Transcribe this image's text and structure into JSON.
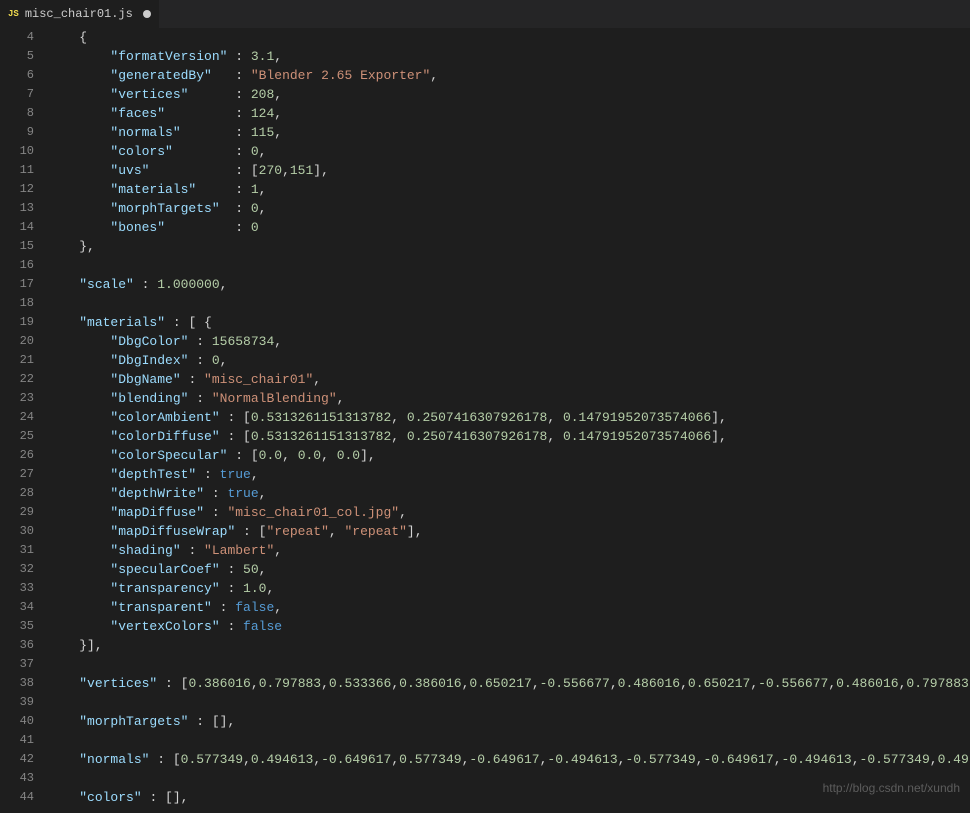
{
  "tab": {
    "filename": "misc_chair01.js",
    "js_label": "JS",
    "unsaved": true
  },
  "gutter": [
    "4",
    "5",
    "6",
    "7",
    "8",
    "9",
    "10",
    "11",
    "12",
    "13",
    "14",
    "15",
    "16",
    "17",
    "18",
    "19",
    "20",
    "21",
    "22",
    "23",
    "24",
    "25",
    "26",
    "27",
    "28",
    "29",
    "30",
    "31",
    "32",
    "33",
    "34",
    "35",
    "36",
    "37",
    "38",
    "39",
    "40",
    "41",
    "42",
    "43",
    "44"
  ],
  "code_lines": [
    [
      [
        "p",
        "    {"
      ]
    ],
    [
      [
        "p",
        "        "
      ],
      [
        "k",
        "\"formatVersion\""
      ],
      [
        "p",
        " : "
      ],
      [
        "n",
        "3.1"
      ],
      [
        "p",
        ","
      ]
    ],
    [
      [
        "p",
        "        "
      ],
      [
        "k",
        "\"generatedBy\""
      ],
      [
        "p",
        "   : "
      ],
      [
        "s",
        "\"Blender 2.65 Exporter\""
      ],
      [
        "p",
        ","
      ]
    ],
    [
      [
        "p",
        "        "
      ],
      [
        "k",
        "\"vertices\""
      ],
      [
        "p",
        "      : "
      ],
      [
        "n",
        "208"
      ],
      [
        "p",
        ","
      ]
    ],
    [
      [
        "p",
        "        "
      ],
      [
        "k",
        "\"faces\""
      ],
      [
        "p",
        "         : "
      ],
      [
        "n",
        "124"
      ],
      [
        "p",
        ","
      ]
    ],
    [
      [
        "p",
        "        "
      ],
      [
        "k",
        "\"normals\""
      ],
      [
        "p",
        "       : "
      ],
      [
        "n",
        "115"
      ],
      [
        "p",
        ","
      ]
    ],
    [
      [
        "p",
        "        "
      ],
      [
        "k",
        "\"colors\""
      ],
      [
        "p",
        "        : "
      ],
      [
        "n",
        "0"
      ],
      [
        "p",
        ","
      ]
    ],
    [
      [
        "p",
        "        "
      ],
      [
        "k",
        "\"uvs\""
      ],
      [
        "p",
        "           : ["
      ],
      [
        "n",
        "270"
      ],
      [
        "p",
        ","
      ],
      [
        "n",
        "151"
      ],
      [
        "p",
        "],"
      ]
    ],
    [
      [
        "p",
        "        "
      ],
      [
        "k",
        "\"materials\""
      ],
      [
        "p",
        "     : "
      ],
      [
        "n",
        "1"
      ],
      [
        "p",
        ","
      ]
    ],
    [
      [
        "p",
        "        "
      ],
      [
        "k",
        "\"morphTargets\""
      ],
      [
        "p",
        "  : "
      ],
      [
        "n",
        "0"
      ],
      [
        "p",
        ","
      ]
    ],
    [
      [
        "p",
        "        "
      ],
      [
        "k",
        "\"bones\""
      ],
      [
        "p",
        "         : "
      ],
      [
        "n",
        "0"
      ]
    ],
    [
      [
        "p",
        "    },"
      ]
    ],
    [
      [
        "p",
        ""
      ]
    ],
    [
      [
        "p",
        "    "
      ],
      [
        "k",
        "\"scale\""
      ],
      [
        "p",
        " : "
      ],
      [
        "n",
        "1.000000"
      ],
      [
        "p",
        ","
      ]
    ],
    [
      [
        "p",
        ""
      ]
    ],
    [
      [
        "p",
        "    "
      ],
      [
        "k",
        "\"materials\""
      ],
      [
        "p",
        " : [ {"
      ]
    ],
    [
      [
        "p",
        "        "
      ],
      [
        "k",
        "\"DbgColor\""
      ],
      [
        "p",
        " : "
      ],
      [
        "n",
        "15658734"
      ],
      [
        "p",
        ","
      ]
    ],
    [
      [
        "p",
        "        "
      ],
      [
        "k",
        "\"DbgIndex\""
      ],
      [
        "p",
        " : "
      ],
      [
        "n",
        "0"
      ],
      [
        "p",
        ","
      ]
    ],
    [
      [
        "p",
        "        "
      ],
      [
        "k",
        "\"DbgName\""
      ],
      [
        "p",
        " : "
      ],
      [
        "s",
        "\"misc_chair01\""
      ],
      [
        "p",
        ","
      ]
    ],
    [
      [
        "p",
        "        "
      ],
      [
        "k",
        "\"blending\""
      ],
      [
        "p",
        " : "
      ],
      [
        "s",
        "\"NormalBlending\""
      ],
      [
        "p",
        ","
      ]
    ],
    [
      [
        "p",
        "        "
      ],
      [
        "k",
        "\"colorAmbient\""
      ],
      [
        "p",
        " : ["
      ],
      [
        "n",
        "0.5313261151313782"
      ],
      [
        "p",
        ", "
      ],
      [
        "n",
        "0.2507416307926178"
      ],
      [
        "p",
        ", "
      ],
      [
        "n",
        "0.14791952073574066"
      ],
      [
        "p",
        "],"
      ]
    ],
    [
      [
        "p",
        "        "
      ],
      [
        "k",
        "\"colorDiffuse\""
      ],
      [
        "p",
        " : ["
      ],
      [
        "n",
        "0.5313261151313782"
      ],
      [
        "p",
        ", "
      ],
      [
        "n",
        "0.2507416307926178"
      ],
      [
        "p",
        ", "
      ],
      [
        "n",
        "0.14791952073574066"
      ],
      [
        "p",
        "],"
      ]
    ],
    [
      [
        "p",
        "        "
      ],
      [
        "k",
        "\"colorSpecular\""
      ],
      [
        "p",
        " : ["
      ],
      [
        "n",
        "0.0"
      ],
      [
        "p",
        ", "
      ],
      [
        "n",
        "0.0"
      ],
      [
        "p",
        ", "
      ],
      [
        "n",
        "0.0"
      ],
      [
        "p",
        "],"
      ]
    ],
    [
      [
        "p",
        "        "
      ],
      [
        "k",
        "\"depthTest\""
      ],
      [
        "p",
        " : "
      ],
      [
        "b",
        "true"
      ],
      [
        "p",
        ","
      ]
    ],
    [
      [
        "p",
        "        "
      ],
      [
        "k",
        "\"depthWrite\""
      ],
      [
        "p",
        " : "
      ],
      [
        "b",
        "true"
      ],
      [
        "p",
        ","
      ]
    ],
    [
      [
        "p",
        "        "
      ],
      [
        "k",
        "\"mapDiffuse\""
      ],
      [
        "p",
        " : "
      ],
      [
        "s",
        "\"misc_chair01_col.jpg\""
      ],
      [
        "p",
        ","
      ]
    ],
    [
      [
        "p",
        "        "
      ],
      [
        "k",
        "\"mapDiffuseWrap\""
      ],
      [
        "p",
        " : ["
      ],
      [
        "s",
        "\"repeat\""
      ],
      [
        "p",
        ", "
      ],
      [
        "s",
        "\"repeat\""
      ],
      [
        "p",
        "],"
      ]
    ],
    [
      [
        "p",
        "        "
      ],
      [
        "k",
        "\"shading\""
      ],
      [
        "p",
        " : "
      ],
      [
        "s",
        "\"Lambert\""
      ],
      [
        "p",
        ","
      ]
    ],
    [
      [
        "p",
        "        "
      ],
      [
        "k",
        "\"specularCoef\""
      ],
      [
        "p",
        " : "
      ],
      [
        "n",
        "50"
      ],
      [
        "p",
        ","
      ]
    ],
    [
      [
        "p",
        "        "
      ],
      [
        "k",
        "\"transparency\""
      ],
      [
        "p",
        " : "
      ],
      [
        "n",
        "1.0"
      ],
      [
        "p",
        ","
      ]
    ],
    [
      [
        "p",
        "        "
      ],
      [
        "k",
        "\"transparent\""
      ],
      [
        "p",
        " : "
      ],
      [
        "b",
        "false"
      ],
      [
        "p",
        ","
      ]
    ],
    [
      [
        "p",
        "        "
      ],
      [
        "k",
        "\"vertexColors\""
      ],
      [
        "p",
        " : "
      ],
      [
        "b",
        "false"
      ]
    ],
    [
      [
        "p",
        "    }],"
      ]
    ],
    [
      [
        "p",
        ""
      ]
    ],
    [
      [
        "p",
        "    "
      ],
      [
        "k",
        "\"vertices\""
      ],
      [
        "p",
        " : ["
      ],
      [
        "n",
        "0.386016"
      ],
      [
        "p",
        ","
      ],
      [
        "n",
        "0.797883"
      ],
      [
        "p",
        ","
      ],
      [
        "n",
        "0.533366"
      ],
      [
        "p",
        ","
      ],
      [
        "n",
        "0.386016"
      ],
      [
        "p",
        ","
      ],
      [
        "n",
        "0.650217"
      ],
      [
        "p",
        ","
      ],
      [
        "n",
        "-0.556677"
      ],
      [
        "p",
        ","
      ],
      [
        "n",
        "0.486016"
      ],
      [
        "p",
        ","
      ],
      [
        "n",
        "0.650217"
      ],
      [
        "p",
        ","
      ],
      [
        "n",
        "-0.556677"
      ],
      [
        "p",
        ","
      ],
      [
        "n",
        "0.486016"
      ],
      [
        "p",
        ","
      ],
      [
        "n",
        "0.797883"
      ]
    ],
    [
      [
        "p",
        ""
      ]
    ],
    [
      [
        "p",
        "    "
      ],
      [
        "k",
        "\"morphTargets\""
      ],
      [
        "p",
        " : [],"
      ]
    ],
    [
      [
        "p",
        ""
      ]
    ],
    [
      [
        "p",
        "    "
      ],
      [
        "k",
        "\"normals\""
      ],
      [
        "p",
        " : ["
      ],
      [
        "n",
        "0.577349"
      ],
      [
        "p",
        ","
      ],
      [
        "n",
        "0.494613"
      ],
      [
        "p",
        ","
      ],
      [
        "n",
        "-0.649617"
      ],
      [
        "p",
        ","
      ],
      [
        "n",
        "0.577349"
      ],
      [
        "p",
        ","
      ],
      [
        "n",
        "-0.649617"
      ],
      [
        "p",
        ","
      ],
      [
        "n",
        "-0.494613"
      ],
      [
        "p",
        ","
      ],
      [
        "n",
        "-0.577349"
      ],
      [
        "p",
        ","
      ],
      [
        "n",
        "-0.649617"
      ],
      [
        "p",
        ","
      ],
      [
        "n",
        "-0.494613"
      ],
      [
        "p",
        ","
      ],
      [
        "n",
        "-0.577349"
      ],
      [
        "p",
        ","
      ],
      [
        "n",
        "0.49"
      ]
    ],
    [
      [
        "p",
        ""
      ]
    ],
    [
      [
        "p",
        "    "
      ],
      [
        "k",
        "\"colors\""
      ],
      [
        "p",
        " : [],"
      ]
    ]
  ],
  "watermark": "http://blog.csdn.net/xundh"
}
